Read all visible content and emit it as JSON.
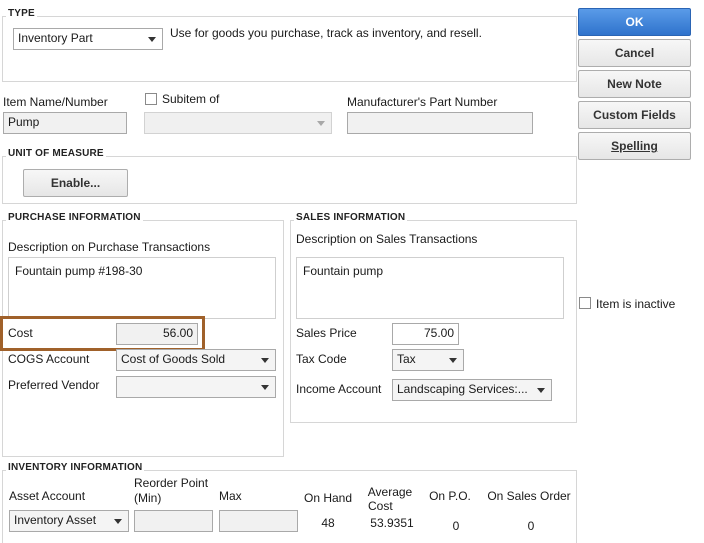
{
  "type_section": {
    "title": "TYPE",
    "selected": "Inventory Part",
    "description": "Use for goods you purchase, track as inventory, and resell."
  },
  "buttons": {
    "ok": "OK",
    "cancel": "Cancel",
    "new_note": "New Note",
    "custom_fields": "Custom Fields",
    "spelling": "Spelling"
  },
  "item": {
    "name_label": "Item Name/Number",
    "name_value": "Pump",
    "subitem_label": "Subitem of",
    "subitem_checked": false,
    "subitem_value": "",
    "mfr_label": "Manufacturer's Part Number",
    "mfr_value": ""
  },
  "uom": {
    "title": "UNIT OF MEASURE",
    "enable_label": "Enable..."
  },
  "purchase": {
    "title": "PURCHASE INFORMATION",
    "desc_label": "Description on Purchase Transactions",
    "desc_value": "Fountain pump #198-30",
    "cost_label": "Cost",
    "cost_value": "56.00",
    "cogs_label": "COGS Account",
    "cogs_value": "Cost of Goods Sold",
    "vendor_label": "Preferred Vendor",
    "vendor_value": ""
  },
  "sales": {
    "title": "SALES INFORMATION",
    "desc_label": "Description on Sales Transactions",
    "desc_value": "Fountain pump",
    "price_label": "Sales Price",
    "price_value": "75.00",
    "tax_label": "Tax Code",
    "tax_value": "Tax",
    "income_label": "Income Account",
    "income_value": "Landscaping Services:..."
  },
  "inactive": {
    "label": "Item is inactive",
    "checked": false
  },
  "inventory": {
    "title": "INVENTORY INFORMATION",
    "asset_label": "Asset Account",
    "asset_value": "Inventory Asset",
    "reorder_label_1": "Reorder Point",
    "reorder_label_2": "(Min)",
    "reorder_value": "",
    "max_label": "Max",
    "max_value": "",
    "on_hand_label": "On Hand",
    "on_hand_value": "48",
    "avg_cost_label_1": "Average",
    "avg_cost_label_2": "Cost",
    "avg_cost_value": "53.9351",
    "on_po_label": "On P.O.",
    "on_po_value": "0",
    "on_sales_order_label": "On Sales Order",
    "on_sales_order_value": "0"
  }
}
